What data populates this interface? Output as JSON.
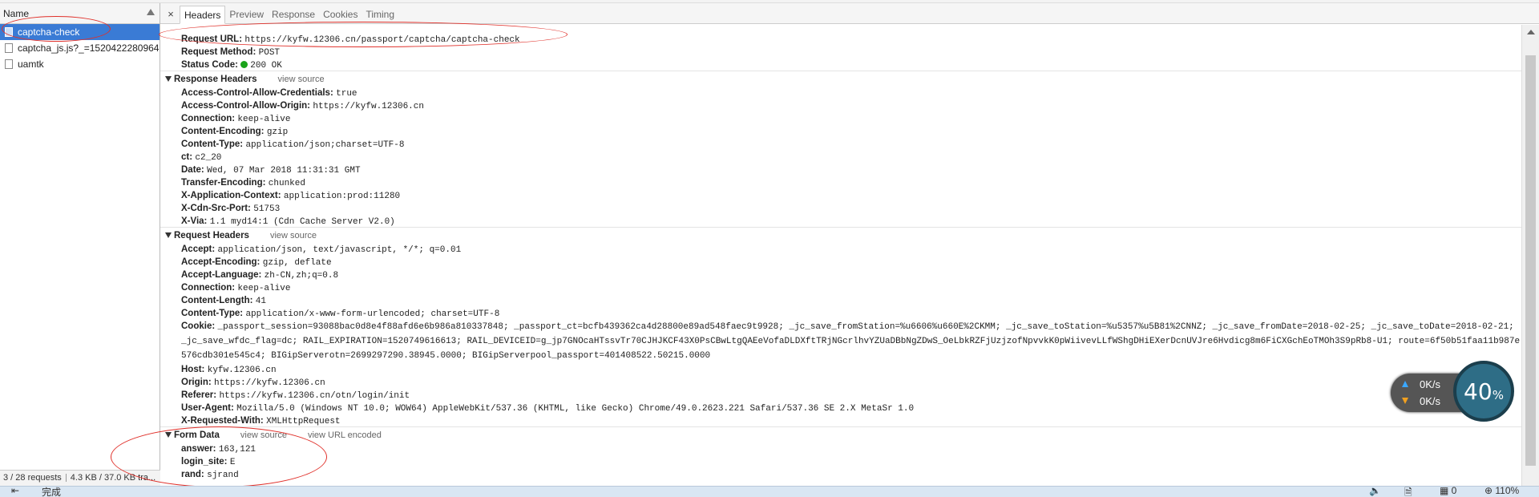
{
  "list": {
    "column": "Name",
    "requests": [
      {
        "name": "captcha-check",
        "selected": true
      },
      {
        "name": "captcha_js.js?_=1520422280964",
        "selected": false
      },
      {
        "name": "uamtk",
        "selected": false
      }
    ],
    "status": {
      "requests": "3 / 28 requests",
      "transfer": "4.3 KB / 37.0 KB tra..."
    }
  },
  "tabs": {
    "close": "×",
    "items": [
      "Headers",
      "Preview",
      "Response",
      "Cookies",
      "Timing"
    ],
    "active": "Headers"
  },
  "general": {
    "request_url_key": "Request URL:",
    "request_url": "https://kyfw.12306.cn/passport/captcha/captcha-check",
    "request_method_key": "Request Method:",
    "request_method": "POST",
    "status_code_key": "Status Code:",
    "status_code": "200 OK",
    "status_color": "#1aa31a"
  },
  "response_headers": {
    "title": "Response Headers",
    "link": "view source",
    "items": [
      {
        "k": "Access-Control-Allow-Credentials:",
        "v": "true"
      },
      {
        "k": "Access-Control-Allow-Origin:",
        "v": "https://kyfw.12306.cn"
      },
      {
        "k": "Connection:",
        "v": "keep-alive"
      },
      {
        "k": "Content-Encoding:",
        "v": "gzip"
      },
      {
        "k": "Content-Type:",
        "v": "application/json;charset=UTF-8"
      },
      {
        "k": "ct:",
        "v": "c2_20"
      },
      {
        "k": "Date:",
        "v": "Wed, 07 Mar 2018 11:31:31 GMT"
      },
      {
        "k": "Transfer-Encoding:",
        "v": "chunked"
      },
      {
        "k": "X-Application-Context:",
        "v": "application:prod:11280"
      },
      {
        "k": "X-Cdn-Src-Port:",
        "v": "51753"
      },
      {
        "k": "X-Via:",
        "v": "1.1 myd14:1 (Cdn Cache Server V2.0)"
      }
    ]
  },
  "request_headers": {
    "title": "Request Headers",
    "link": "view source",
    "items": [
      {
        "k": "Accept:",
        "v": "application/json, text/javascript, */*; q=0.01"
      },
      {
        "k": "Accept-Encoding:",
        "v": "gzip, deflate"
      },
      {
        "k": "Accept-Language:",
        "v": "zh-CN,zh;q=0.8"
      },
      {
        "k": "Connection:",
        "v": "keep-alive"
      },
      {
        "k": "Content-Length:",
        "v": "41"
      },
      {
        "k": "Content-Type:",
        "v": "application/x-www-form-urlencoded; charset=UTF-8"
      },
      {
        "k": "Cookie:",
        "v": "_passport_session=93088bac0d8e4f88afd6e6b986a810337848; _passport_ct=bcfb439362ca4d28800e89ad548faec9t9928; _jc_save_fromStation=%u6606%u660E%2CKMM; _jc_save_toStation=%u5357%u5B81%2CNNZ; _jc_save_fromDate=2018-02-25; _jc_save_toDate=2018-02-21; _jc_save_wfdc_flag=dc; RAIL_EXPIRATION=1520749616613; RAIL_DEVICEID=g_jp7GNOcaHTssvTr70CJHJKCF43X0PsCBwLtgQAEeVofaDLDXftTRjNGcrlhvYZUaDBbNgZDwS_OeLbkRZFjUzjzofNpvvkK0pWiivevLLfWShgDHiEXerDcnUVJre6Hvdicg8m6FiCXGchEoTMOh3S9pRb8-U1; route=6f50b51faa11b987e576cdb301e545c4; BIGipServerotn=2699297290.38945.0000; BIGipServerpool_passport=401408522.50215.0000",
        "wrap": true
      },
      {
        "k": "Host:",
        "v": "kyfw.12306.cn"
      },
      {
        "k": "Origin:",
        "v": "https://kyfw.12306.cn"
      },
      {
        "k": "Referer:",
        "v": "https://kyfw.12306.cn/otn/login/init"
      },
      {
        "k": "User-Agent:",
        "v": "Mozilla/5.0 (Windows NT 10.0; WOW64) AppleWebKit/537.36 (KHTML, like Gecko) Chrome/49.0.2623.221 Safari/537.36 SE 2.X MetaSr 1.0"
      },
      {
        "k": "X-Requested-With:",
        "v": "XMLHttpRequest"
      }
    ]
  },
  "form_data": {
    "title": "Form Data",
    "link1": "view source",
    "link2": "view URL encoded",
    "items": [
      {
        "k": "answer:",
        "v": "163,121"
      },
      {
        "k": "login_site:",
        "v": "E"
      },
      {
        "k": "rand:",
        "v": "sjrand"
      }
    ]
  },
  "widget": {
    "up": "0K/s",
    "down": "0K/s",
    "percent": "40",
    "percent_sign": "%",
    "up_color": "#3aa7ff",
    "down_color": "#f0a020"
  },
  "bottombar": {
    "done": "完成",
    "count": "0",
    "zoom": "110%"
  }
}
